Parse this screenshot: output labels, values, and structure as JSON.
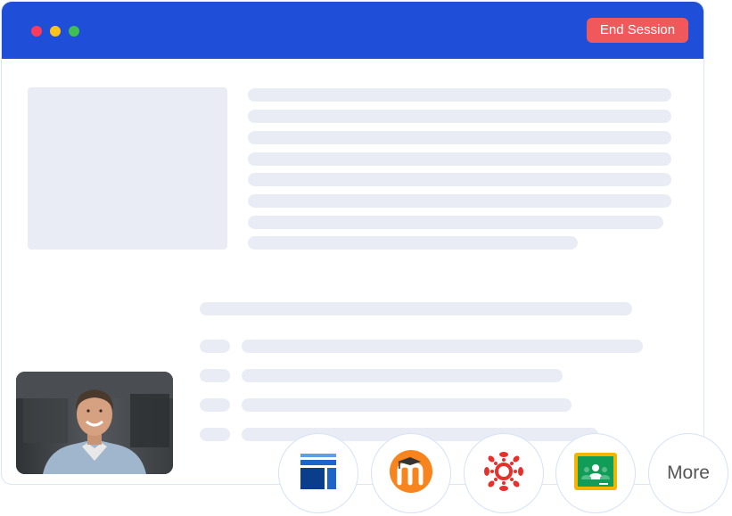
{
  "header": {
    "end_session_label": "End Session",
    "accent_color": "#1f4fd8",
    "button_color": "#f0595c"
  },
  "integrations": {
    "items": [
      {
        "icon": "blackboard-icon"
      },
      {
        "icon": "moodle-icon"
      },
      {
        "icon": "canvas-icon"
      },
      {
        "icon": "google-classroom-icon"
      }
    ],
    "more_label": "More"
  }
}
